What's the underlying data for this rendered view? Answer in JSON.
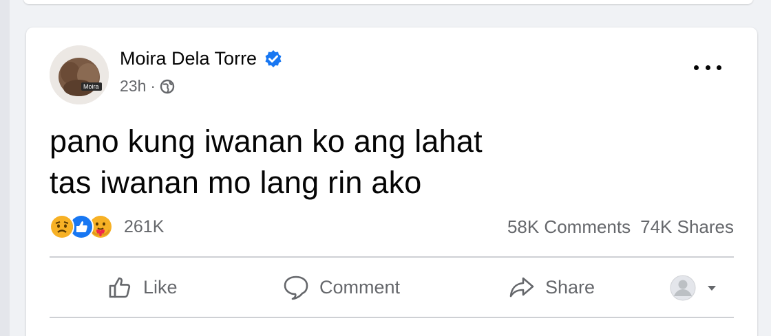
{
  "post": {
    "author": "Moira Dela Torre",
    "time": "23h",
    "separator": "·",
    "text_line1": "pano kung iwanan ko ang lahat",
    "text_line2": "tas iwanan mo lang rin ako",
    "reaction_count": "261K",
    "comments": "58K Comments",
    "shares": "74K Shares"
  },
  "actions": {
    "like": "Like",
    "comment": "Comment",
    "share": "Share"
  },
  "icons": {
    "verified": "verified-badge-icon",
    "globe": "globe-icon",
    "more": "more-options-icon",
    "reactions": [
      "sad-reaction-icon",
      "like-reaction-icon",
      "care-reaction-icon"
    ]
  },
  "colors": {
    "verified_blue": "#1877f2",
    "text": "#050505",
    "secondary_text": "#65676b"
  }
}
